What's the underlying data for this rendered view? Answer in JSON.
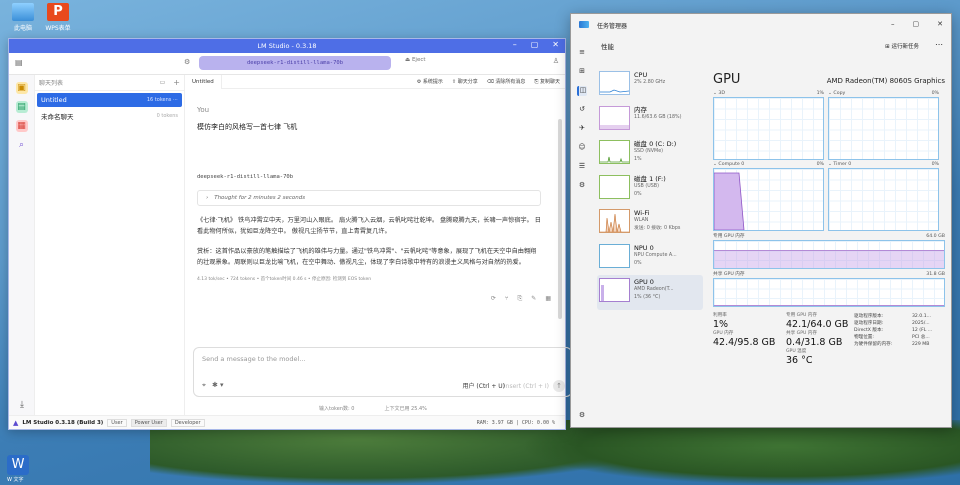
{
  "desktop": {
    "icons": [
      {
        "label": "此电脑"
      },
      {
        "label": "WPS表单"
      }
    ],
    "tray_label": "W 文字"
  },
  "lm": {
    "title": "LM Studio - 0.3.18",
    "model": "deepseek-r1-distill-llama-70b",
    "eject": "Eject",
    "chats_header": "聊天列表",
    "chats": [
      {
        "title": "Untitled",
        "count": "16 tokens",
        "active": true
      },
      {
        "title": "未命名聊天",
        "count": "0 tokens",
        "active": false
      }
    ],
    "tab": "Untitled",
    "tools": [
      "系统提示",
      "聊天分享",
      "清除所有消息",
      "复制聊天"
    ],
    "you_label": "You",
    "prompt": "模仿李白的风格写一首七律 飞机",
    "model_label": "deepseek-r1-distill-llama-70b",
    "thought": "Thought for 2 minutes 2 seconds",
    "para1": "《七律·飞机》 铁鸟冲霄立中天，万里河山入眼底。 扇火腾飞入云烟，云帆叱咤壮乾坤。 盘腾窥腾九天，长啸一声惊宿宇。 日看此物何所似，犹如巨龙降空中。 傲视凡尘扬节节，直上青霄复几许。",
    "para2": "赏析：这首作品以豪放的笔触描绘了飞机的雄伟与力量。通过\"铁鸟冲霄\"、\"云帆叱咤\"等意象，展现了飞机在天空中自由翱翔的壮观景象。周联则以巨龙比喻飞机，在空中舞动、傲视凡尘，体现了李白诗歌中特有的浪漫主义风格与对自然的热爱。",
    "stats": "4.13 tok/sec • 724 tokens • 首个token时间 0.46 s • 停止原因: 检测到 EOS token",
    "input_placeholder": "Send a message to the model...",
    "user_btn": "用户 (Ctrl + U)",
    "insert_btn": "Insert (Ctrl + I)",
    "tokens_left": "输入token数: 0",
    "tokens_right": "上下文已用 25.4%",
    "version": "LM Studio 0.3.18 (Build 3)",
    "modes": [
      "User",
      "Power User",
      "Developer"
    ],
    "resources": "RAM: 3.97 GB | CPU: 0.00 %"
  },
  "tm": {
    "title": "任务管理器",
    "section": "性能",
    "run_task": "运行新任务",
    "sidebar": [
      {
        "name": "CPU",
        "l2": "2% 2.80 GHz",
        "l3": ""
      },
      {
        "name": "内存",
        "l2": "11.6/63.6 GB (18%)",
        "l3": ""
      },
      {
        "name": "磁盘 0 (C: D:)",
        "l2": "SSD (NVMe)",
        "l3": "1%"
      },
      {
        "name": "磁盘 1 (F:)",
        "l2": "USB (USB)",
        "l3": "0%"
      },
      {
        "name": "Wi-Fi",
        "l2": "WLAN",
        "l3": "发送: 0 接收: 0 Kbps"
      },
      {
        "name": "NPU 0",
        "l2": "NPU Compute A...",
        "l3": "0%"
      },
      {
        "name": "GPU 0",
        "l2": "AMD Radeon(T...",
        "l3": "1% (36 °C)"
      }
    ],
    "gpu_title": "GPU",
    "gpu_model": "AMD Radeon(TM) 8060S Graphics",
    "graphs": [
      {
        "label": "3D",
        "pct": "1%"
      },
      {
        "label": "Copy",
        "pct": "0%"
      },
      {
        "label": "Compute 0",
        "pct": "0%"
      },
      {
        "label": "Timer 0",
        "pct": "0%"
      }
    ],
    "dedicated_label": "专用 GPU 内存",
    "dedicated_max": "64.0 GB",
    "shared_label": "共享 GPU 内存",
    "shared_max": "31.8 GB",
    "stats": [
      {
        "label": "利用率",
        "value": "1%"
      },
      {
        "label": "专用 GPU 内存",
        "value": "42.1/64.0 GB"
      },
      {
        "label": "GPU 内存",
        "value": "42.4/95.8 GB"
      },
      {
        "label": "共享 GPU 内存",
        "value": "0.4/31.8 GB"
      },
      {
        "label": "GPU 温度",
        "value": "36 °C"
      }
    ],
    "kv": [
      {
        "k": "驱动程序版本:",
        "v": "32.0.1..."
      },
      {
        "k": "驱动程序日期:",
        "v": "2025/..."
      },
      {
        "k": "DirectX 版本:",
        "v": "12 (FL ..."
      },
      {
        "k": "物理位置:",
        "v": "PCI 总..."
      },
      {
        "k": "为硬件保留的内存:",
        "v": "229 MB"
      }
    ]
  }
}
